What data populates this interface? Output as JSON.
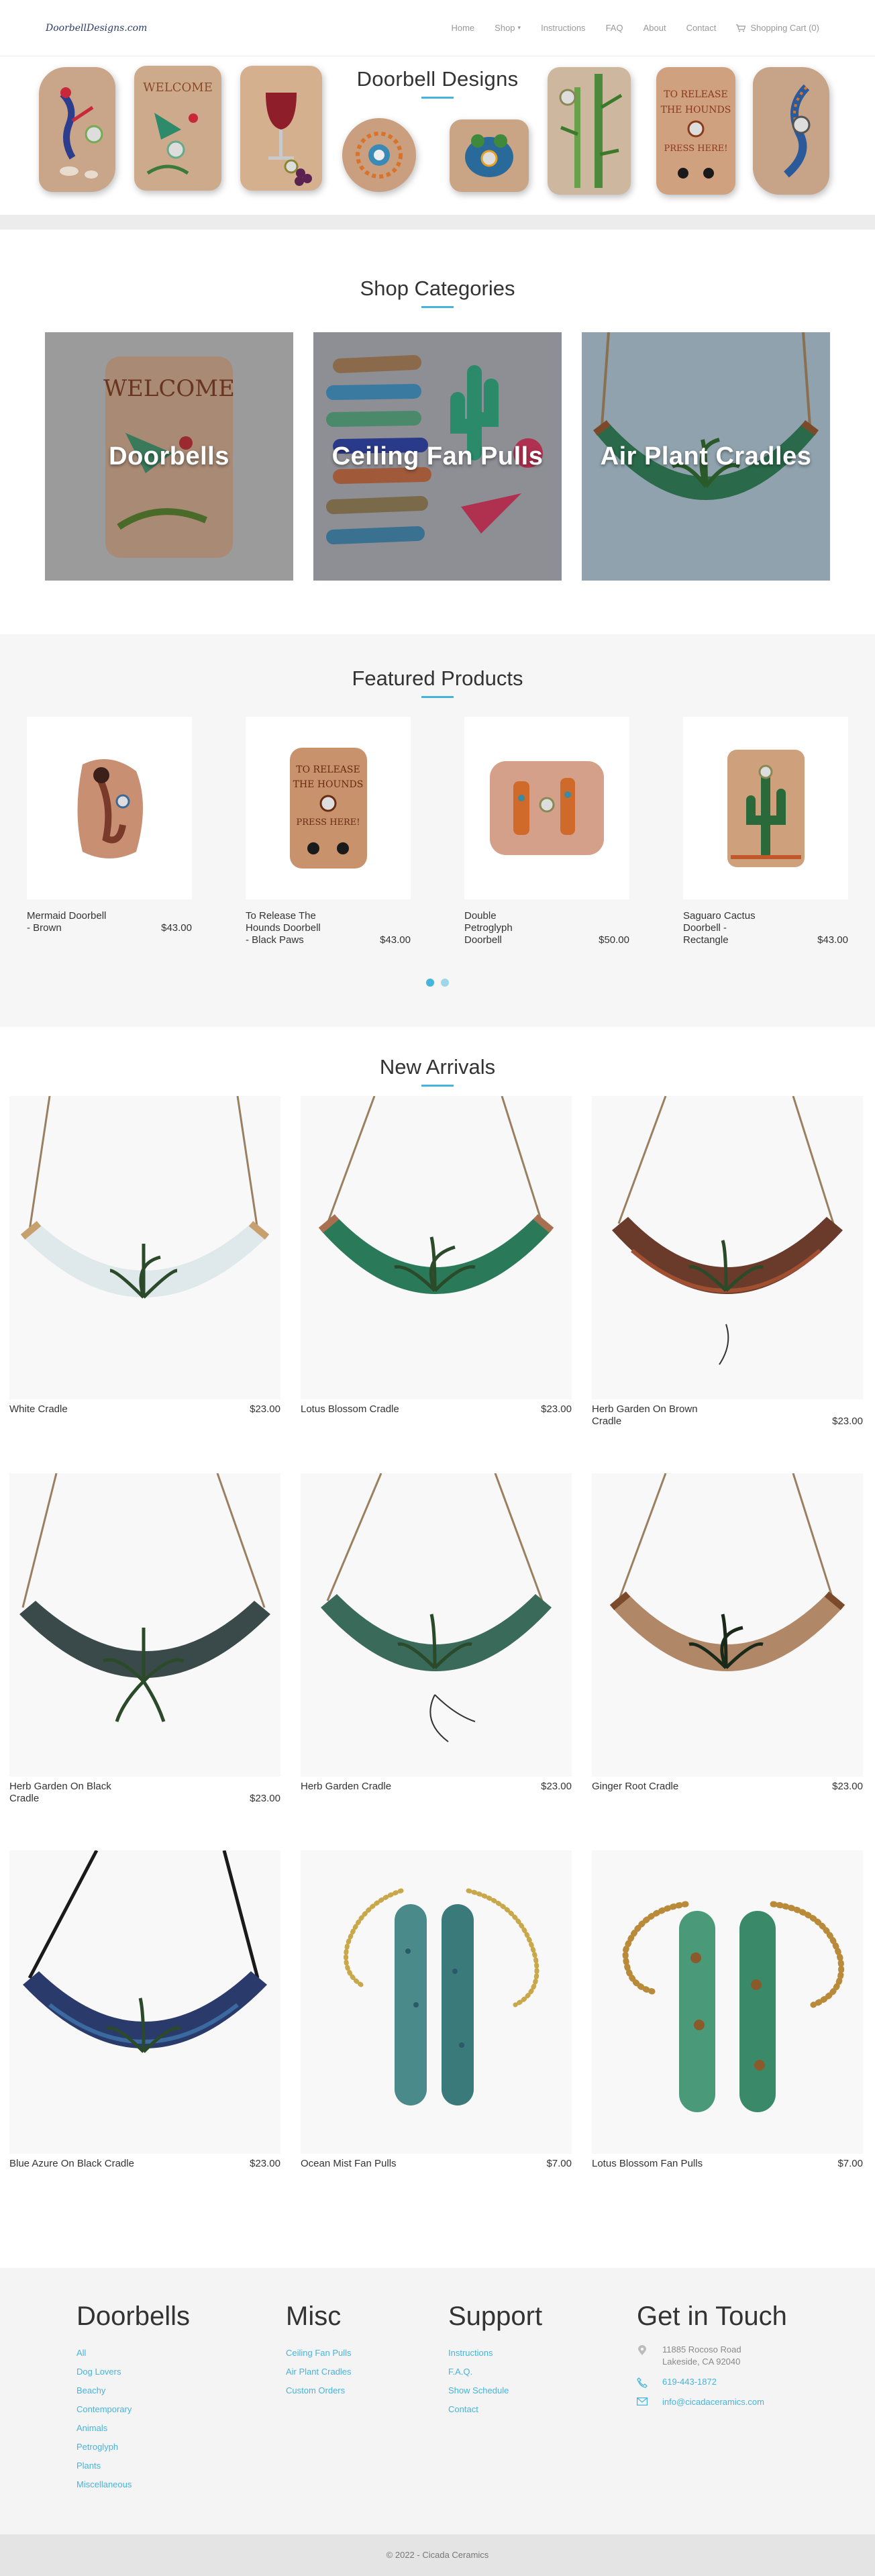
{
  "nav": {
    "logo": "DoorbellDesigns.com",
    "items": [
      "Home",
      "Shop",
      "Instructions",
      "FAQ",
      "About",
      "Contact"
    ],
    "cart": "Shopping Cart (0)"
  },
  "hero": {
    "title": "Doorbell Designs"
  },
  "categories": {
    "title": "Shop Categories",
    "items": [
      "Doorbells",
      "Ceiling Fan Pulls",
      "Air Plant Cradles"
    ]
  },
  "featured": {
    "title": "Featured Products",
    "items": [
      {
        "name": "Mermaid Doorbell - Brown",
        "price": "$43.00"
      },
      {
        "name": "To Release The Hounds Doorbell - Black Paws",
        "price": "$43.00"
      },
      {
        "name": "Double Petroglyph Doorbell",
        "price": "$50.00"
      },
      {
        "name": "Saguaro Cactus Doorbell - Rectangle",
        "price": "$43.00"
      }
    ]
  },
  "arrivals": {
    "title": "New Arrivals",
    "items": [
      {
        "name": "White Cradle",
        "price": "$23.00"
      },
      {
        "name": "Lotus Blossom Cradle",
        "price": "$23.00"
      },
      {
        "name": "Herb Garden On Brown Cradle",
        "price": "$23.00"
      },
      {
        "name": "Herb Garden On Black Cradle",
        "price": "$23.00"
      },
      {
        "name": "Herb Garden Cradle",
        "price": "$23.00"
      },
      {
        "name": "Ginger Root Cradle",
        "price": "$23.00"
      },
      {
        "name": "Blue Azure On Black Cradle",
        "price": "$23.00"
      },
      {
        "name": "Ocean Mist Fan Pulls",
        "price": "$7.00"
      },
      {
        "name": "Lotus Blossom Fan Pulls",
        "price": "$7.00"
      }
    ]
  },
  "footer": {
    "doorbells": {
      "title": "Doorbells",
      "links": [
        "All",
        "Dog Lovers",
        "Beachy",
        "Contemporary",
        "Animals",
        "Petroglyph",
        "Plants",
        "Miscellaneous"
      ]
    },
    "misc": {
      "title": "Misc",
      "links": [
        "Ceiling Fan Pulls",
        "Air Plant Cradles",
        "Custom Orders"
      ]
    },
    "support": {
      "title": "Support",
      "links": [
        "Instructions",
        "F.A.Q.",
        "Show Schedule",
        "Contact"
      ]
    },
    "contact": {
      "title": "Get in Touch",
      "address1": "11885 Rocoso Road",
      "address2": "Lakeside, CA 92040",
      "phone": "619-443-1872",
      "email": "info@cicadaceramics.com"
    },
    "copyright": "© 2022 - Cicada Ceramics"
  },
  "colors": {
    "accent": "#46b4dc"
  }
}
